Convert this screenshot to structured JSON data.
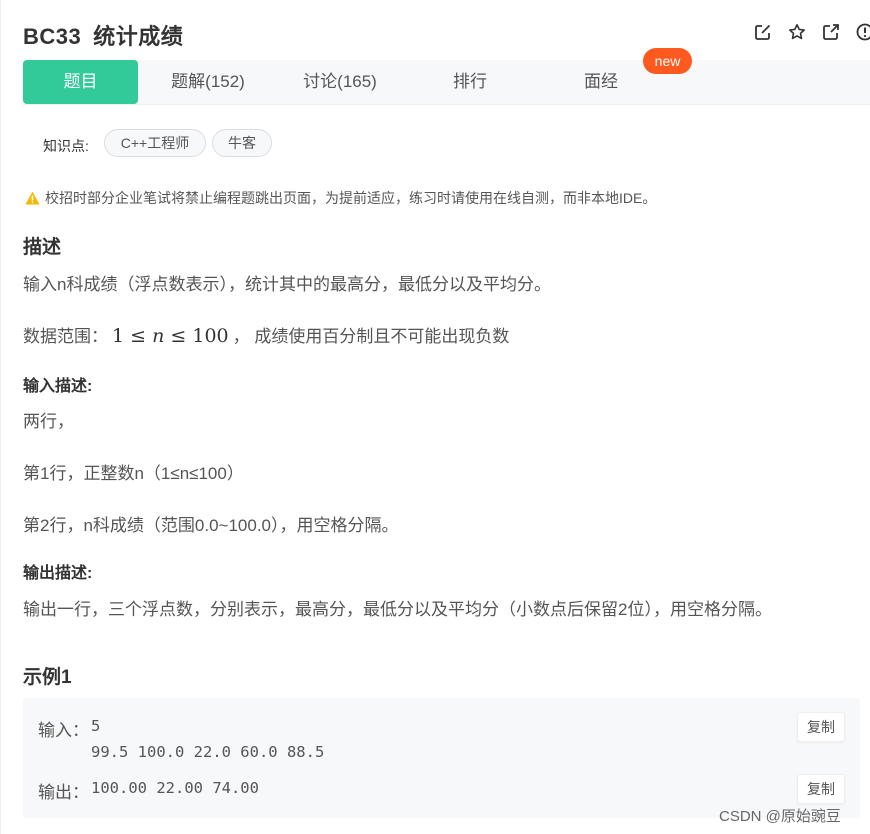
{
  "header": {
    "problem_id": "BC33",
    "problem_title": "统计成绩",
    "icons": [
      "edit-icon",
      "star-icon",
      "external-link-icon",
      "report-icon"
    ]
  },
  "tabs": [
    {
      "label": "题目",
      "active": true
    },
    {
      "label": "题解(152)",
      "active": false
    },
    {
      "label": "讨论(165)",
      "active": false
    },
    {
      "label": "排行",
      "active": false
    },
    {
      "label": "面经",
      "active": false
    }
  ],
  "new_badge": "new",
  "knowledge": {
    "label": "知识点:",
    "tags": [
      "C++工程师",
      "牛客"
    ]
  },
  "warning": {
    "text": "校招时部分企业笔试将禁止编程题跳出页面，为提前适应，练习时请使用在线自测，而非本地IDE。",
    "color": "#f5b800"
  },
  "description": {
    "heading": "描述",
    "line1": "输入n科成绩（浮点数表示），统计其中的最高分，最低分以及平均分。",
    "range_prefix": "数据范围：",
    "range_math": {
      "lower": "1",
      "op1": "≤",
      "var": "n",
      "op2": "≤",
      "upper": "100"
    },
    "range_suffix": "，  成绩使用百分制且不可能出现负数"
  },
  "input_desc": {
    "heading": "输入描述:",
    "lines": [
      "两行，",
      "第1行，正整数n（1≤n≤100）",
      "第2行，n科成绩（范围0.0~100.0），用空格分隔。"
    ]
  },
  "output_desc": {
    "heading": "输出描述:",
    "line": "输出一行，三个浮点数，分别表示，最高分，最低分以及平均分（小数点后保留2位），用空格分隔。"
  },
  "example": {
    "heading": "示例1",
    "input_label": "输入：",
    "input_lines": [
      "5",
      "99.5 100.0 22.0 60.0 88.5"
    ],
    "output_label": "输出：",
    "output_line": "100.00 22.00 74.00",
    "copy_label": "复制"
  },
  "watermark": "CSDN @原始豌豆",
  "colors": {
    "accent": "#32ca99",
    "badge": "#fe5a1f"
  }
}
